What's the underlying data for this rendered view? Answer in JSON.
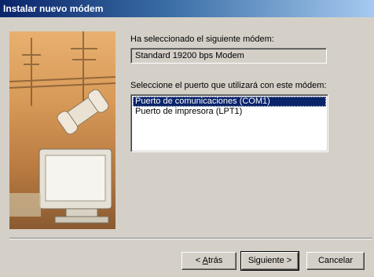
{
  "window": {
    "title": "Instalar nuevo módem"
  },
  "content": {
    "selected_modem_label": "Ha seleccionado el siguiente módem:",
    "selected_modem_value": "Standard 19200 bps Modem",
    "port_label": "Seleccione el puerto que utilizará con este módem:",
    "ports": [
      {
        "label": "Puerto de comunicaciones (COM1)",
        "selected": true
      },
      {
        "label": "Puerto de impresora (LPT1)",
        "selected": false
      }
    ]
  },
  "buttons": {
    "back_prefix": "< ",
    "back_mnemonic": "A",
    "back_rest": "trás",
    "next_label": "Siguiente >",
    "cancel_label": "Cancelar"
  },
  "illustration": {
    "icon": "modem-wizard-illustration"
  },
  "colors": {
    "titlebar_start": "#0a246a",
    "titlebar_end": "#a6caf0",
    "selection": "#0a246a",
    "face": "#d4d0c8"
  }
}
